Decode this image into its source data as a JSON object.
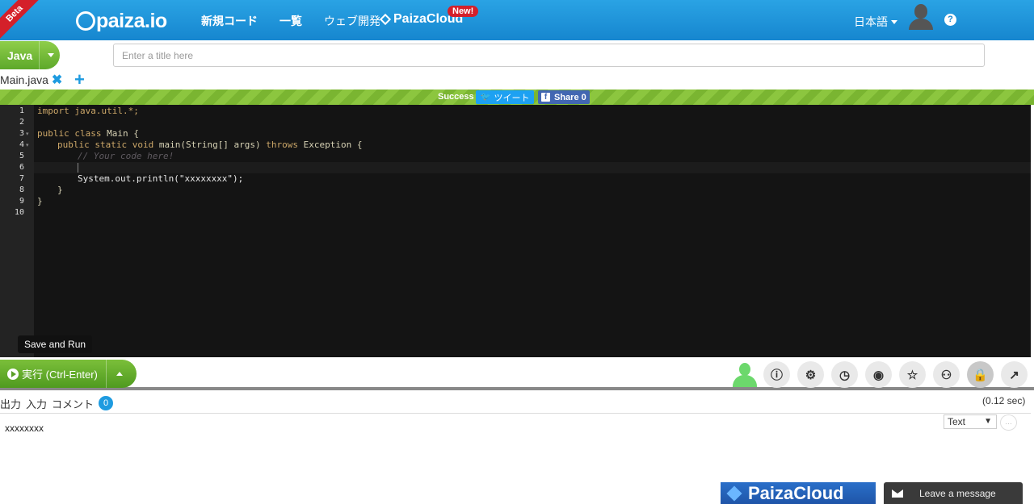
{
  "header": {
    "beta": "Beta",
    "logo": "paiza.io",
    "nav": [
      "新規コード",
      "一覧",
      "ウェブ開発"
    ],
    "cloud_brand": "PaizaCloud",
    "new_badge": "New!",
    "language": "日本語",
    "help": "?"
  },
  "toolbar": {
    "language": "Java",
    "title_placeholder": "Enter a title here"
  },
  "tabs": [
    {
      "name": "Main.java"
    }
  ],
  "status": {
    "text": "Success",
    "tweet": "ツイート",
    "share": "Share 0"
  },
  "editor": {
    "line_numbers": [
      "1",
      "2",
      "3",
      "4",
      "5",
      "6",
      "7",
      "8",
      "9",
      "10"
    ],
    "lines": {
      "l1": "import java.util.*;",
      "l3_kw": "public class",
      "l3_rest": " Main {",
      "l4_kw1": "public static void",
      "l4_mid": " main(String[] args) ",
      "l4_kw2": "throws",
      "l4_rest": " Exception {",
      "l5": "// Your code here!",
      "l7": "System.out.println(\"xxxxxxxx\");",
      "l8": "}",
      "l9": "}"
    }
  },
  "tooltip": "Save and Run",
  "run": {
    "label": "実行 (Ctrl-Enter)"
  },
  "tools": [
    "info-icon",
    "gear-icon",
    "clock-icon",
    "github-icon",
    "star-icon",
    "users-icon",
    "lock-icon",
    "share-icon"
  ],
  "output": {
    "tabs": [
      "出力",
      "入力",
      "コメント"
    ],
    "comment_count": "0",
    "time": "(0.12 sec)",
    "format": "Text",
    "text": "xxxxxxxx"
  },
  "footer": {
    "cloud_banner": "PaizaCloud",
    "chat": "Leave a message"
  },
  "colors": {
    "header": "#1686cf",
    "accent_green": "#5da82a",
    "editor_bg": "#141414"
  }
}
